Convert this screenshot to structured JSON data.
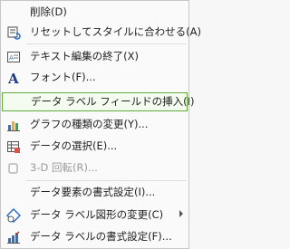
{
  "menu": {
    "items": [
      {
        "label": "削除(D)",
        "icon": "none"
      },
      {
        "label": "リセットしてスタイルに合わせる(A)",
        "icon": "reset-style-icon"
      },
      {
        "label": "テキスト編集の終了(X)",
        "icon": "exit-text-edit-icon"
      },
      {
        "label": "フォント(F)...",
        "icon": "font-icon"
      },
      {
        "label": "データ ラベル フィールドの挿入(I)",
        "icon": "none"
      },
      {
        "label": "グラフの種類の変更(Y)...",
        "icon": "change-chart-type-icon"
      },
      {
        "label": "データの選択(E)...",
        "icon": "select-data-icon"
      },
      {
        "label": "3-D 回転(R)...",
        "icon": "3d-rotation-icon",
        "disabled": true
      },
      {
        "label": "データ要素の書式設定(I)...",
        "icon": "none"
      },
      {
        "label": "データ ラベル図形の変更(C)",
        "icon": "change-shape-icon",
        "submenu": true
      },
      {
        "label": "データ ラベルの書式設定(F)...",
        "icon": "format-data-labels-icon"
      }
    ]
  },
  "colors": {
    "highlight_border": "#5faa3a",
    "disabled_text": "#9a9a9a"
  }
}
